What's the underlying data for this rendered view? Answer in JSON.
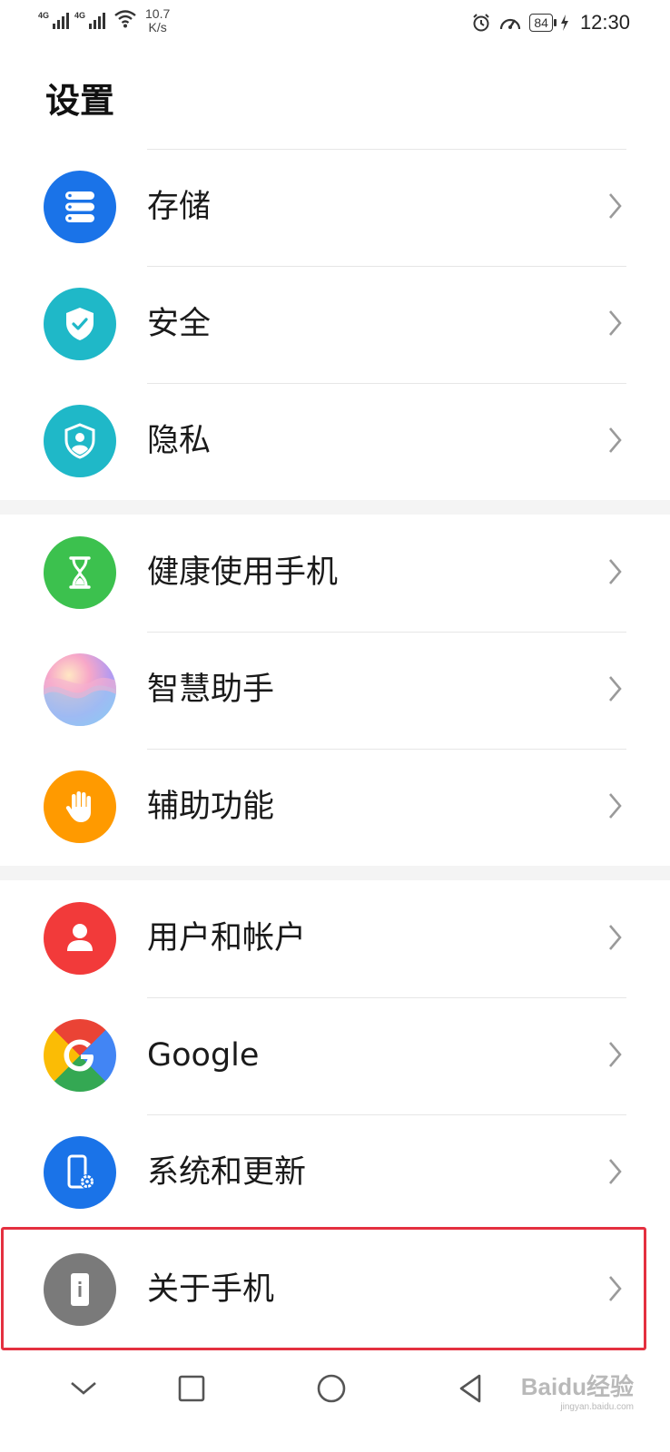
{
  "status_bar": {
    "sim1_tag": "4G",
    "sim2_tag": "4G",
    "speed_value": "10.7",
    "speed_unit": "K/s",
    "battery": "84",
    "time": "12:30"
  },
  "page": {
    "title": "设置"
  },
  "groups": [
    {
      "items": [
        {
          "label": "存储",
          "icon": "storage-icon",
          "color": "#1a73e8"
        },
        {
          "label": "安全",
          "icon": "shield-check-icon",
          "color": "#1fb8c8"
        },
        {
          "label": "隐私",
          "icon": "privacy-shield-icon",
          "color": "#1fb8c8"
        }
      ]
    },
    {
      "items": [
        {
          "label": "健康使用手机",
          "icon": "hourglass-icon",
          "color": "#3cc14e"
        },
        {
          "label": "智慧助手",
          "icon": "assistant-orb-icon",
          "color": "#c4a0f0"
        },
        {
          "label": "辅助功能",
          "icon": "hand-icon",
          "color": "#ff9a00"
        }
      ]
    },
    {
      "items": [
        {
          "label": "用户和帐户",
          "icon": "user-icon",
          "color": "#f23a3a"
        },
        {
          "label": "Google",
          "icon": "google-icon",
          "color": "#4285f4"
        },
        {
          "label": "系统和更新",
          "icon": "phone-settings-icon",
          "color": "#1a73e8"
        },
        {
          "label": "关于手机",
          "icon": "phone-info-icon",
          "color": "#7a7a7a"
        }
      ]
    }
  ],
  "watermark": {
    "brand": "Baidu经验",
    "url": "jingyan.baidu.com"
  }
}
